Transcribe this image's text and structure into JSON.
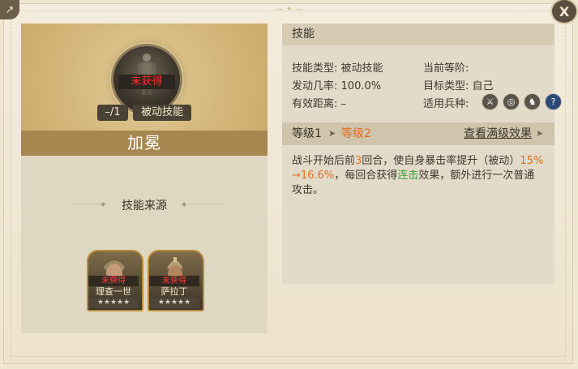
{
  "skill": {
    "name": "加冕",
    "status": "未获得",
    "level_tag": "–/1",
    "type_tag": "被动技能"
  },
  "source": {
    "title": "技能来源",
    "heroes": [
      {
        "name": "理查一世",
        "status": "未获得",
        "stars": "★★★★★"
      },
      {
        "name": "萨拉丁",
        "status": "未获得",
        "stars": "★★★★★"
      }
    ]
  },
  "panel": {
    "header": "技能",
    "type_label": "技能类型:",
    "type_value": "被动技能",
    "stage_label": "当前等阶:",
    "stage_value": "",
    "rate_label": "发动几率:",
    "rate_value": "100.0%",
    "target_label": "目标类型:",
    "target_value": "自己",
    "range_label": "有效距离:",
    "range_value": "–",
    "troop_label": "适用兵种:",
    "troop_icons": [
      "sword-icon",
      "bow-target-icon",
      "horse-icon",
      "question-icon"
    ]
  },
  "levels": {
    "from": "等级1",
    "arrow": "➤",
    "to": "等级2",
    "max_link": "查看满级效果",
    "max_arrow": "➤"
  },
  "description": {
    "p1": "战斗开始后前",
    "n1": "3",
    "p2": "回合，使自身暴击率提升（被动）",
    "n2": "15% →16.6%",
    "p3": "，每回合获得",
    "g1": "连击",
    "p4": "效果，额外进行一次普通攻击。"
  },
  "colors": {
    "accent_orange": "#e07020",
    "accent_green": "#3aa336",
    "unowned_red": "#ff2b2b",
    "name_bar": "#a7874f"
  },
  "top_icons": {
    "share": "share-icon",
    "close": "X"
  }
}
